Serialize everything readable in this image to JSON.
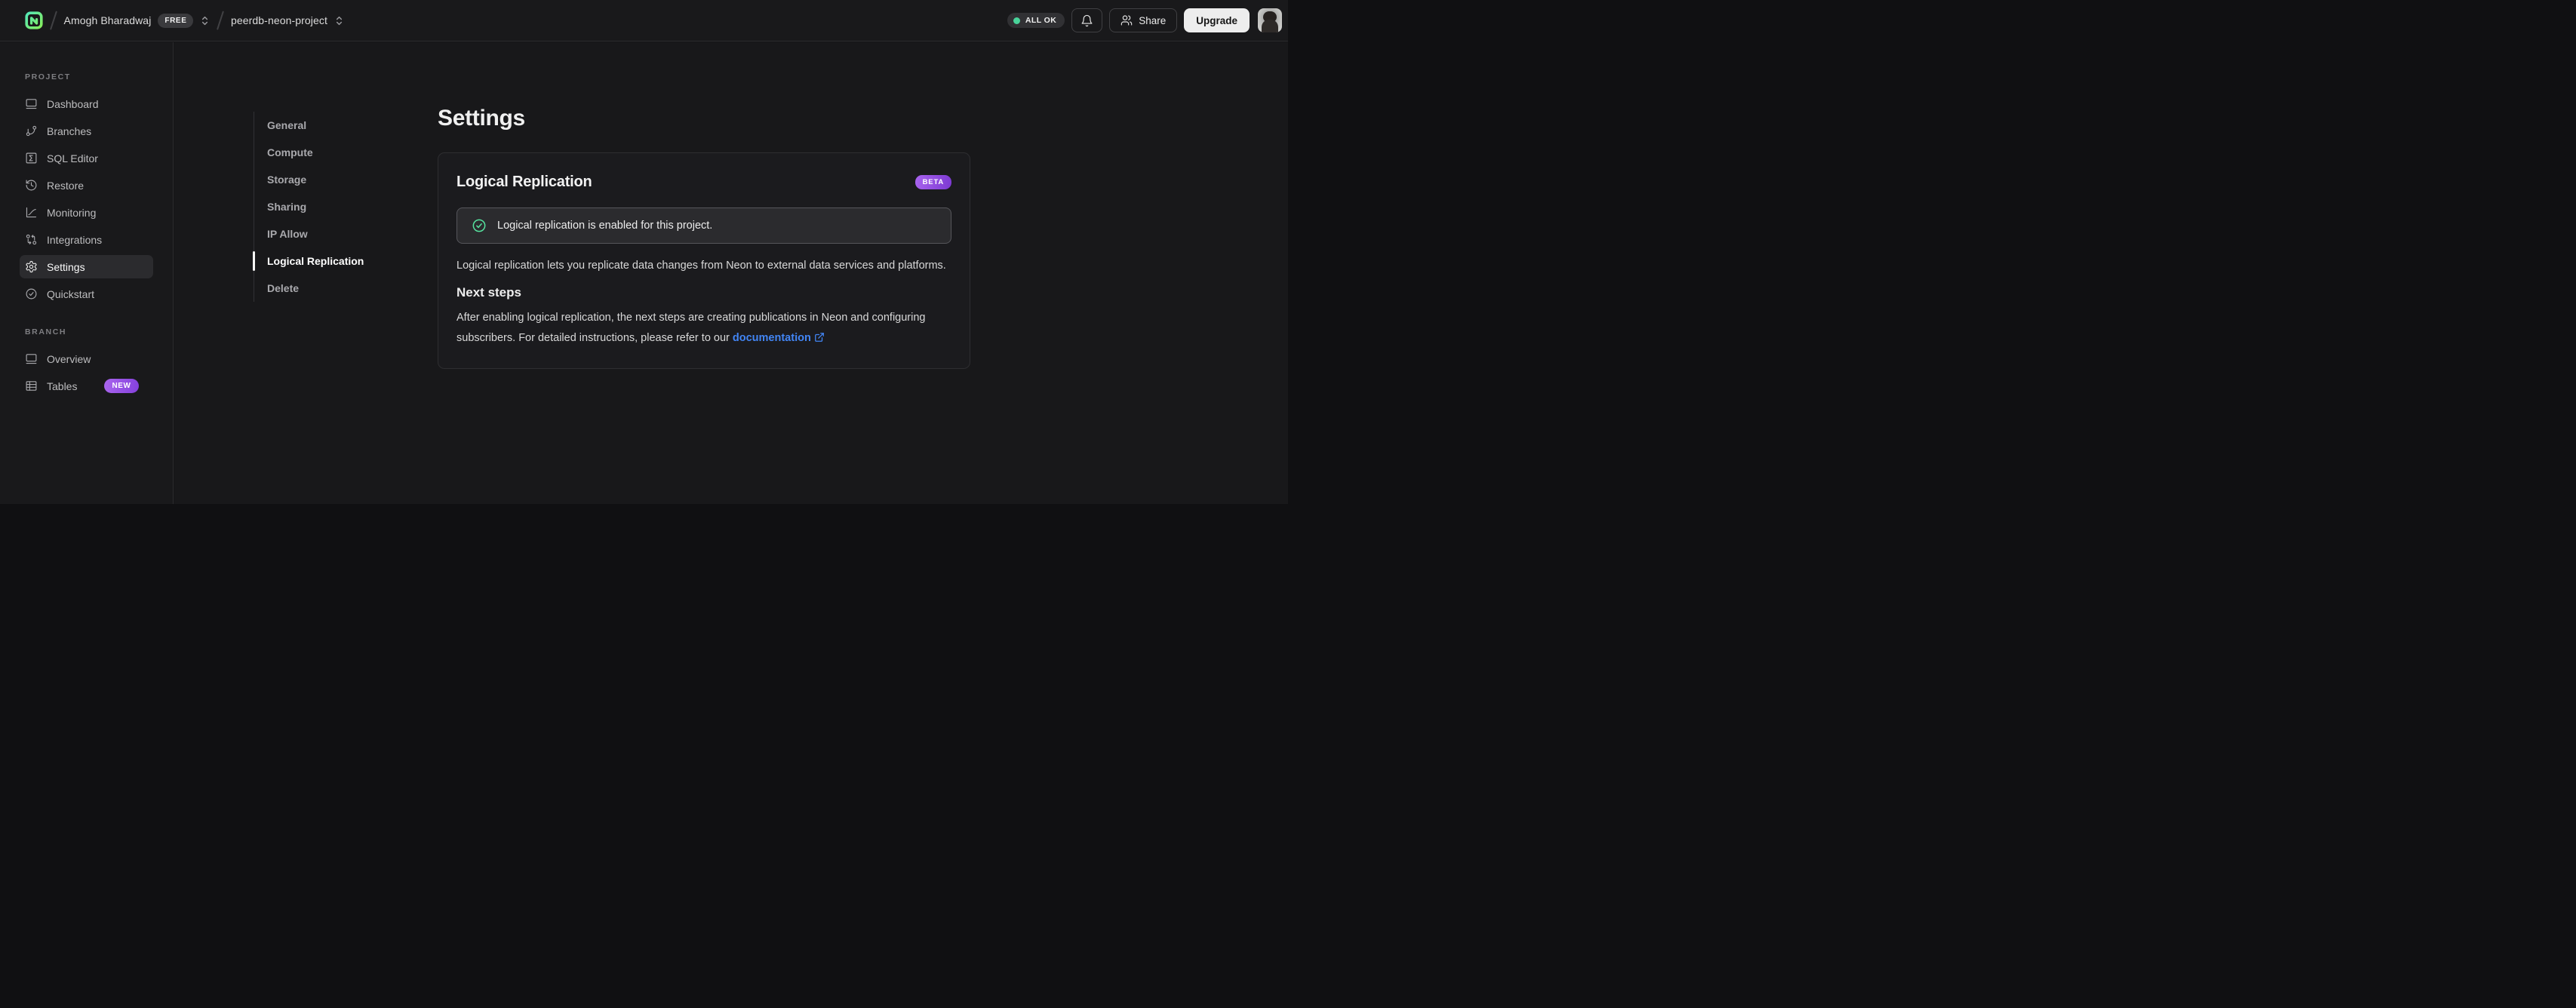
{
  "topbar": {
    "breadcrumb": {
      "org_name": "Amogh Bharadwaj",
      "org_badge": "FREE",
      "project_name": "peerdb-neon-project"
    },
    "status_label": "ALL OK",
    "share_label": "Share",
    "upgrade_label": "Upgrade"
  },
  "sidebar": {
    "sections": [
      {
        "label": "PROJECT",
        "items": [
          {
            "label": "Dashboard",
            "icon": "dashboard-icon",
            "active": false
          },
          {
            "label": "Branches",
            "icon": "branches-icon",
            "active": false
          },
          {
            "label": "SQL Editor",
            "icon": "sql-editor-icon",
            "active": false
          },
          {
            "label": "Restore",
            "icon": "restore-icon",
            "active": false
          },
          {
            "label": "Monitoring",
            "icon": "monitoring-icon",
            "active": false
          },
          {
            "label": "Integrations",
            "icon": "integrations-icon",
            "active": false
          },
          {
            "label": "Settings",
            "icon": "settings-icon",
            "active": true
          },
          {
            "label": "Quickstart",
            "icon": "quickstart-icon",
            "active": false
          }
        ]
      },
      {
        "label": "BRANCH",
        "items": [
          {
            "label": "Overview",
            "icon": "overview-icon",
            "active": false
          },
          {
            "label": "Tables",
            "icon": "tables-icon",
            "active": false,
            "badge": "NEW"
          }
        ]
      }
    ]
  },
  "settings_nav": {
    "items": [
      {
        "label": "General",
        "active": false
      },
      {
        "label": "Compute",
        "active": false
      },
      {
        "label": "Storage",
        "active": false
      },
      {
        "label": "Sharing",
        "active": false
      },
      {
        "label": "IP Allow",
        "active": false
      },
      {
        "label": "Logical Replication",
        "active": true
      },
      {
        "label": "Delete",
        "active": false
      }
    ]
  },
  "main": {
    "page_title": "Settings",
    "card": {
      "title": "Logical Replication",
      "badge": "BETA",
      "alert_message": "Logical replication is enabled for this project.",
      "description": "Logical replication lets you replicate data changes from Neon to external data services and platforms.",
      "next_steps_title": "Next steps",
      "next_steps_text": "After enabling logical replication, the next steps are creating publications in Neon and configuring subscribers. For detailed instructions, please refer to our ",
      "link_label": "documentation"
    }
  },
  "colors": {
    "accent_green": "#49d39a",
    "badge_purple_start": "#aa66ee",
    "badge_purple_end": "#8440dc",
    "link_blue": "#4285f4",
    "background": "#18181a",
    "card_background": "#1b1b1e",
    "border": "#2b2b2e"
  }
}
